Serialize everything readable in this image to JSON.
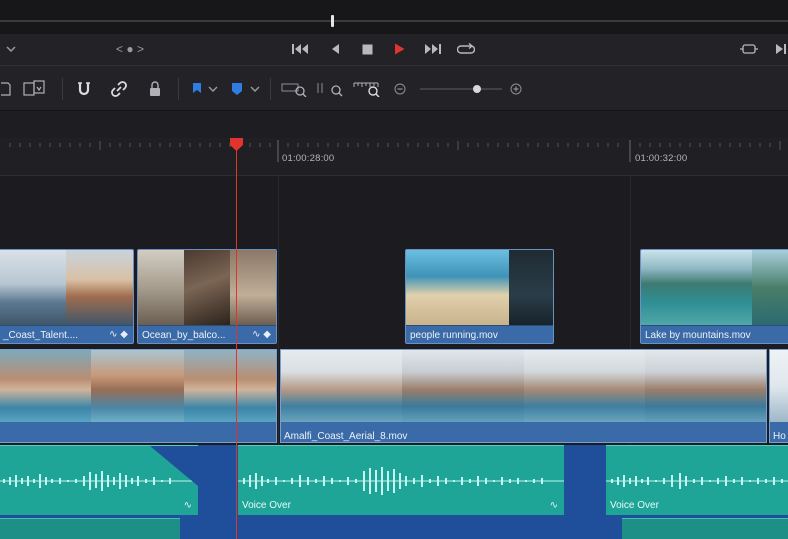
{
  "transport": {
    "jog_indicator": "< ● >"
  },
  "ruler": {
    "timecodes": [
      "01:00:28:00",
      "01:00:32:00"
    ]
  },
  "clips": {
    "v2": [
      {
        "name": "_Coast_Talent....",
        "colors": [
          "#c9d3dc",
          "#8fa4b8",
          "#d6c2a8",
          "#5b6d7c"
        ]
      },
      {
        "name": "Ocean_by_balco...",
        "colors": [
          "#c7c0b3",
          "#7b6d5d",
          "#3a2f26",
          "#a99b86"
        ]
      },
      {
        "name": "people running.mov",
        "colors": [
          "#4aa6c8",
          "#d9c6a2",
          "#1f3a46",
          "#233644"
        ]
      },
      {
        "name": "Lake by mountains.mov",
        "colors": [
          "#9fc9d9",
          "#2f6f7a",
          "#4c8f6a",
          "#bcd6de"
        ]
      }
    ],
    "v1": [
      {
        "name": "",
        "colors": [
          "#6aa0b8",
          "#c89a7a",
          "#4b86a6"
        ]
      },
      {
        "name": "Amalfi_Coast_Aerial_8.mov",
        "colors": [
          "#dfe4e6",
          "#a58a76",
          "#3f7fa0",
          "#cfd8de"
        ]
      },
      {
        "name": "Ho",
        "colors": [
          "#dfe7ee"
        ]
      }
    ],
    "a1": [
      {
        "name": ""
      },
      {
        "name": "Voice Over"
      },
      {
        "name": "Voice Over"
      }
    ]
  },
  "accent": {
    "playhead": "#e2342e",
    "video_clip": "#3a6aa8",
    "audio_clip": "#1fa597",
    "play_button": "#e2342e",
    "flag": "#2f7de0"
  }
}
